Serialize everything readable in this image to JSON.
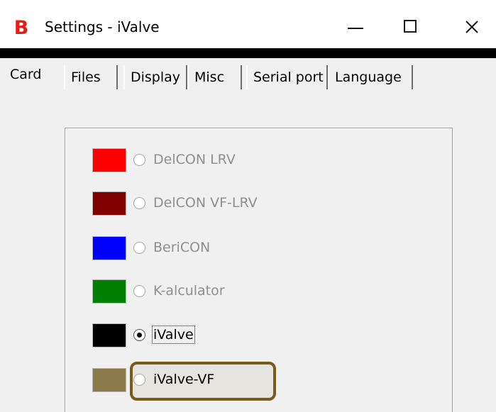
{
  "window": {
    "title": "Settings - iValve",
    "logo": "B",
    "controls": {
      "minimize": "minimize-icon",
      "maximize": "maximize-icon",
      "close": "close-icon"
    }
  },
  "tabs": [
    {
      "label": "Card",
      "selected": true
    },
    {
      "label": "Files",
      "selected": false
    },
    {
      "label": "Display",
      "selected": false
    },
    {
      "label": "Misc",
      "selected": false
    },
    {
      "label": "Serial port",
      "selected": false
    },
    {
      "label": "Language",
      "selected": false
    }
  ],
  "card_options": [
    {
      "label": "DelCON LRV",
      "color": "#ff0000",
      "checked": false,
      "enabled": false
    },
    {
      "label": "DelCON VF-LRV",
      "color": "#800000",
      "checked": false,
      "enabled": false
    },
    {
      "label": "BeriCON",
      "color": "#0000ff",
      "checked": false,
      "enabled": false
    },
    {
      "label": "K-alculator",
      "color": "#008000",
      "checked": false,
      "enabled": false
    },
    {
      "label": "iValve",
      "color": "#000000",
      "checked": true,
      "enabled": true
    },
    {
      "label": "iValve-VF",
      "color": "#8b7b4a",
      "checked": false,
      "enabled": true,
      "highlighted": true
    }
  ],
  "colors": {
    "logo": "#e41e12",
    "highlight_border": "#7a5a1a"
  }
}
